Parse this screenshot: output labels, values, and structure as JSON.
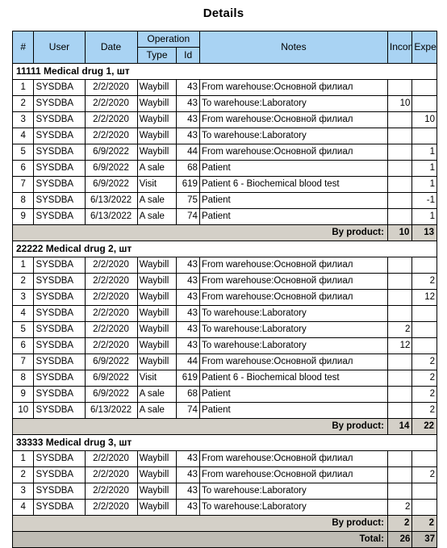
{
  "report": {
    "title": "Details",
    "columns": {
      "num": "#",
      "user": "User",
      "date": "Date",
      "operation": "Operation",
      "type": "Type",
      "id": "Id",
      "notes": "Notes",
      "income": "Income",
      "expenses": "Expenses"
    },
    "labels": {
      "by_product": "By product:",
      "total": "Total:"
    },
    "colors": {
      "header_background": "#a9d3f3",
      "summary_background": "#d4d0c8",
      "total_background": "#bfbcb4",
      "border": "#000000",
      "page_background": "#ffffff"
    },
    "groups": [
      {
        "heading": "11111 Medical drug 1, шт",
        "rows": [
          {
            "num": "1",
            "user": "SYSDBA",
            "date": "2/2/2020",
            "type": "Waybill",
            "id": "43",
            "notes": "From warehouse:Основной филиал",
            "income": "",
            "expenses": ""
          },
          {
            "num": "2",
            "user": "SYSDBA",
            "date": "2/2/2020",
            "type": "Waybill",
            "id": "43",
            "notes": "To warehouse:Laboratory",
            "income": "10",
            "expenses": ""
          },
          {
            "num": "3",
            "user": "SYSDBA",
            "date": "2/2/2020",
            "type": "Waybill",
            "id": "43",
            "notes": "From warehouse:Основной филиал",
            "income": "",
            "expenses": "10"
          },
          {
            "num": "4",
            "user": "SYSDBA",
            "date": "2/2/2020",
            "type": "Waybill",
            "id": "43",
            "notes": "To warehouse:Laboratory",
            "income": "",
            "expenses": ""
          },
          {
            "num": "5",
            "user": "SYSDBA",
            "date": "6/9/2022",
            "type": "Waybill",
            "id": "44",
            "notes": "From warehouse:Основной филиал",
            "income": "",
            "expenses": "1"
          },
          {
            "num": "6",
            "user": "SYSDBA",
            "date": "6/9/2022",
            "type": "A sale",
            "id": "68",
            "notes": "Patient",
            "income": "",
            "expenses": "1"
          },
          {
            "num": "7",
            "user": "SYSDBA",
            "date": "6/9/2022",
            "type": "Visit",
            "id": "619",
            "notes": "Patient 6 - Biochemical blood test",
            "income": "",
            "expenses": "1"
          },
          {
            "num": "8",
            "user": "SYSDBA",
            "date": "6/13/2022",
            "type": "A sale",
            "id": "75",
            "notes": "Patient",
            "income": "",
            "expenses": "-1"
          },
          {
            "num": "9",
            "user": "SYSDBA",
            "date": "6/13/2022",
            "type": "A sale",
            "id": "74",
            "notes": "Patient",
            "income": "",
            "expenses": "1"
          }
        ],
        "summary": {
          "label": "By product:",
          "income": "10",
          "expenses": "13"
        }
      },
      {
        "heading": "22222 Medical drug 2, шт",
        "rows": [
          {
            "num": "1",
            "user": "SYSDBA",
            "date": "2/2/2020",
            "type": "Waybill",
            "id": "43",
            "notes": "From warehouse:Основной филиал",
            "income": "",
            "expenses": ""
          },
          {
            "num": "2",
            "user": "SYSDBA",
            "date": "2/2/2020",
            "type": "Waybill",
            "id": "43",
            "notes": "From warehouse:Основной филиал",
            "income": "",
            "expenses": "2"
          },
          {
            "num": "3",
            "user": "SYSDBA",
            "date": "2/2/2020",
            "type": "Waybill",
            "id": "43",
            "notes": "From warehouse:Основной филиал",
            "income": "",
            "expenses": "12"
          },
          {
            "num": "4",
            "user": "SYSDBA",
            "date": "2/2/2020",
            "type": "Waybill",
            "id": "43",
            "notes": "To warehouse:Laboratory",
            "income": "",
            "expenses": ""
          },
          {
            "num": "5",
            "user": "SYSDBA",
            "date": "2/2/2020",
            "type": "Waybill",
            "id": "43",
            "notes": "To warehouse:Laboratory",
            "income": "2",
            "expenses": ""
          },
          {
            "num": "6",
            "user": "SYSDBA",
            "date": "2/2/2020",
            "type": "Waybill",
            "id": "43",
            "notes": "To warehouse:Laboratory",
            "income": "12",
            "expenses": ""
          },
          {
            "num": "7",
            "user": "SYSDBA",
            "date": "6/9/2022",
            "type": "Waybill",
            "id": "44",
            "notes": "From warehouse:Основной филиал",
            "income": "",
            "expenses": "2"
          },
          {
            "num": "8",
            "user": "SYSDBA",
            "date": "6/9/2022",
            "type": "Visit",
            "id": "619",
            "notes": "Patient 6 - Biochemical blood test",
            "income": "",
            "expenses": "2"
          },
          {
            "num": "9",
            "user": "SYSDBA",
            "date": "6/9/2022",
            "type": "A sale",
            "id": "68",
            "notes": "Patient",
            "income": "",
            "expenses": "2"
          },
          {
            "num": "10",
            "user": "SYSDBA",
            "date": "6/13/2022",
            "type": "A sale",
            "id": "74",
            "notes": "Patient",
            "income": "",
            "expenses": "2"
          }
        ],
        "summary": {
          "label": "By product:",
          "income": "14",
          "expenses": "22"
        }
      },
      {
        "heading": "33333 Medical drug 3, шт",
        "rows": [
          {
            "num": "1",
            "user": "SYSDBA",
            "date": "2/2/2020",
            "type": "Waybill",
            "id": "43",
            "notes": "From warehouse:Основной филиал",
            "income": "",
            "expenses": ""
          },
          {
            "num": "2",
            "user": "SYSDBA",
            "date": "2/2/2020",
            "type": "Waybill",
            "id": "43",
            "notes": "From warehouse:Основной филиал",
            "income": "",
            "expenses": "2"
          },
          {
            "num": "3",
            "user": "SYSDBA",
            "date": "2/2/2020",
            "type": "Waybill",
            "id": "43",
            "notes": "To warehouse:Laboratory",
            "income": "",
            "expenses": ""
          },
          {
            "num": "4",
            "user": "SYSDBA",
            "date": "2/2/2020",
            "type": "Waybill",
            "id": "43",
            "notes": "To warehouse:Laboratory",
            "income": "2",
            "expenses": ""
          }
        ],
        "summary": {
          "label": "By product:",
          "income": "2",
          "expenses": "2"
        }
      }
    ],
    "total": {
      "label": "Total:",
      "income": "26",
      "expenses": "37"
    }
  }
}
